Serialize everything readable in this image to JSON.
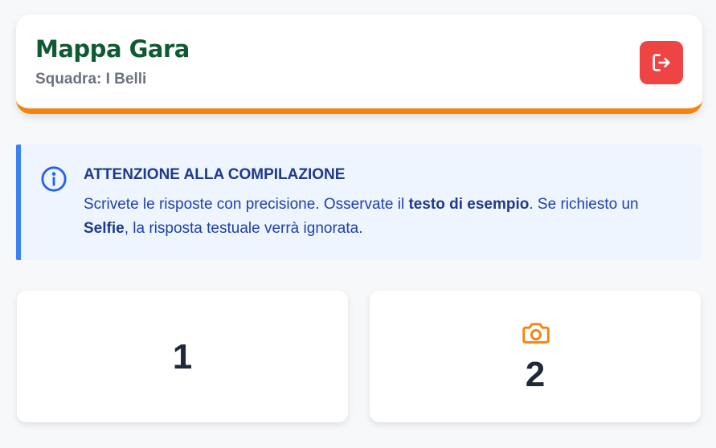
{
  "header": {
    "title": "Mappa Gara",
    "subtitle": "Squadra: I Belli",
    "logout_icon": "logout-icon",
    "accent_color": "#f5840f",
    "title_color": "#0f5a32",
    "logout_color": "#ef4444"
  },
  "notice": {
    "icon": "info-icon",
    "title": "ATTENZIONE ALLA COMPILAZIONE",
    "text_1": "Scrivete le risposte con precisione. Osservate il ",
    "bold_1": "testo di esempio",
    "text_2": ". Se richiesto un ",
    "bold_2": "Selfie",
    "text_3": ", la risposta testuale verrà ignorata.",
    "border_color": "#3b82f6",
    "background": "#eef5fe"
  },
  "cards": [
    {
      "number": "1",
      "icon": ""
    },
    {
      "number": "2",
      "icon": "camera-icon",
      "icon_color": "#f5840f"
    }
  ]
}
